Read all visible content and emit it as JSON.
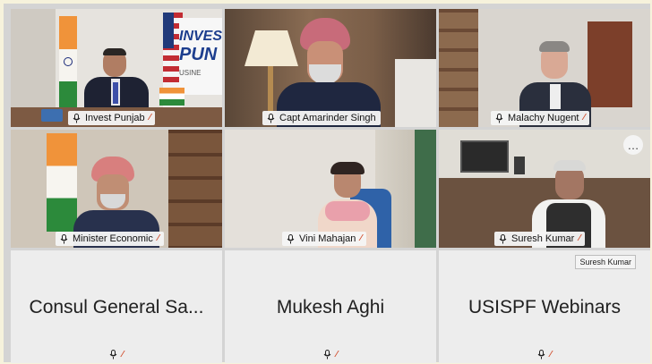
{
  "tiles": [
    {
      "label": "Invest Punjab",
      "wall_text": [
        "INVEST",
        "PUN"
      ],
      "sign_text": "USINE"
    },
    {
      "label": "Capt Amarinder Singh"
    },
    {
      "label": "Malachy Nugent"
    },
    {
      "label": "Minister Economic"
    },
    {
      "label": "Vini Mahajan"
    },
    {
      "label": "Suresh Kumar",
      "tooltip": "Suresh Kumar",
      "more_icon": "…"
    },
    {
      "big_name": "Consul General Sa..."
    },
    {
      "big_name": "Mukesh Aghi"
    },
    {
      "big_name": "USISPF Webinars"
    }
  ],
  "icons": {
    "mic": "mic-icon",
    "muted": "muted-slash-icon",
    "more": "more-options-icon"
  },
  "colors": {
    "muted": "#d24b2a",
    "tile_bg": "#ededed",
    "frame_bg": "#d4d4d4",
    "page_bg": "#f6f2dc"
  }
}
